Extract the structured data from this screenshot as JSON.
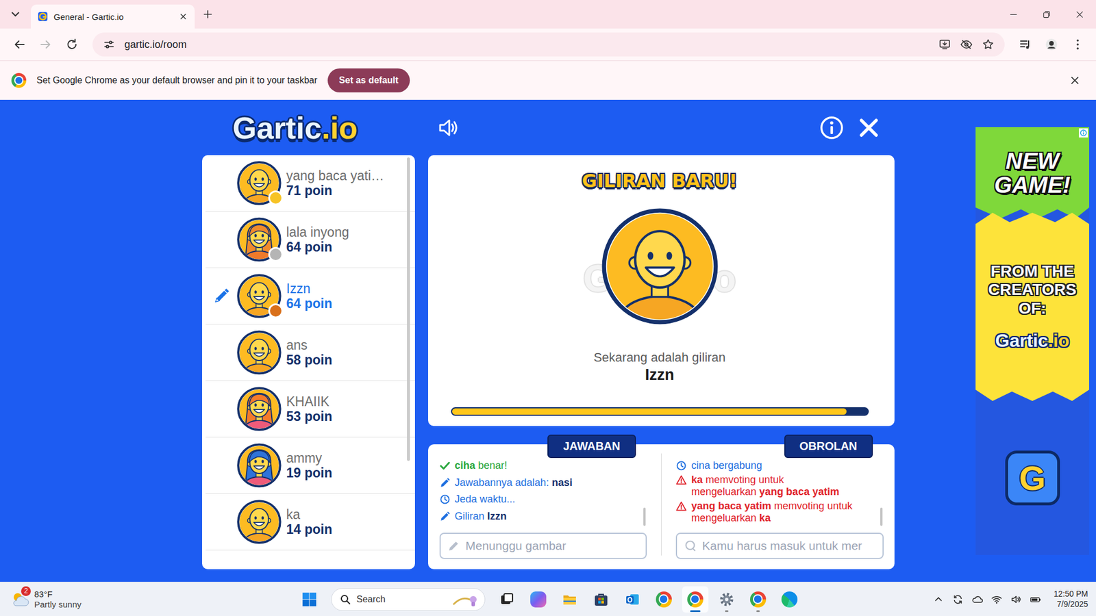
{
  "browser": {
    "tabs": [
      {
        "title": "General - Gartic.io",
        "selected": true
      }
    ],
    "address": "gartic.io/room",
    "infobar": {
      "message": "Set Google Chrome as your default browser and pin it to your taskbar",
      "button": "Set as default"
    }
  },
  "game": {
    "logo": {
      "main": "Gartic",
      "suffix": ".io"
    },
    "sound_on": true,
    "players": [
      {
        "name": "yang baca yati…",
        "points": "71 poin",
        "drawing": false,
        "avatar": {
          "kind": "man",
          "hair": null,
          "shirt": "#f6a623"
        },
        "color": "#f7c325"
      },
      {
        "name": "lala inyong",
        "points": "64 poin",
        "drawing": false,
        "avatar": {
          "kind": "woman",
          "hair": "#f08a2c",
          "shirt": "#f07a2a"
        },
        "color": "#b5b5b5"
      },
      {
        "name": "Izzn",
        "points": "64 poin",
        "drawing": true,
        "avatar": {
          "kind": "man",
          "hair": null,
          "shirt": "#f6a623"
        },
        "color": "#d9701a"
      },
      {
        "name": "ans",
        "points": "58 poin",
        "drawing": false,
        "avatar": {
          "kind": "man",
          "hair": null,
          "shirt": "#f6a623"
        },
        "color": null
      },
      {
        "name": "KHAIIK",
        "points": "53 poin",
        "drawing": false,
        "avatar": {
          "kind": "woman",
          "hair": "#f47b2a",
          "shirt": "#ef5b7a"
        },
        "color": null
      },
      {
        "name": "ammy",
        "points": "19 poin",
        "drawing": false,
        "avatar": {
          "kind": "woman",
          "hair": "#2f73d9",
          "shirt": "#ef5b7a"
        },
        "color": null
      },
      {
        "name": "ka",
        "points": "14 poin",
        "drawing": false,
        "avatar": {
          "kind": "man",
          "hair": null,
          "shirt": "#f6a623"
        },
        "color": null
      }
    ],
    "turn": {
      "title": "GILIRAN BARU!",
      "watermark": {
        "main": "Gartic",
        "suffix": ".io"
      },
      "avatar": {
        "kind": "man",
        "hair": null,
        "shirt": "#f6a623"
      },
      "caption": "Sekarang adalah giliran",
      "player": "Izzn",
      "level": 0.95
    },
    "answers": {
      "tab": "JAWABAN",
      "placeholder": "Menunggu gambar",
      "entries": [
        {
          "kind": "correct",
          "parts": [
            {
              "text": "ciha",
              "bold": true
            },
            {
              "text": "benar!",
              "bold": false
            }
          ]
        },
        {
          "kind": "answer",
          "parts": [
            {
              "text": "Jawabannya adalah:",
              "bold": false
            },
            {
              "text": "nasi",
              "bold": true
            }
          ]
        },
        {
          "kind": "pause",
          "parts": [
            {
              "text": "Jeda waktu...",
              "bold": false
            }
          ]
        },
        {
          "kind": "turn",
          "parts": [
            {
              "text": "Giliran",
              "bold": false
            },
            {
              "text": "Izzn",
              "bold": true
            }
          ]
        }
      ]
    },
    "chat": {
      "tab": "OBROLAN",
      "placeholder": "Kamu harus masuk untuk mer",
      "entries": [
        {
          "kind": "join",
          "parts": [
            {
              "text": "cina bergabung",
              "bold": false
            }
          ]
        },
        {
          "kind": "vote",
          "parts": [
            {
              "text": "ka",
              "bold": true
            },
            {
              "text": "memvoting untuk mengeluarkan",
              "bold": false
            },
            {
              "text": "yang baca yatim",
              "bold": true
            }
          ]
        },
        {
          "kind": "vote",
          "parts": [
            {
              "text": "yang baca yatim",
              "bold": true
            },
            {
              "text": "memvoting untuk mengeluarkan",
              "bold": false
            },
            {
              "text": "ka",
              "bold": true
            }
          ]
        }
      ]
    }
  },
  "ad": {
    "headline": "NEW GAME!",
    "subline": "FROM THE CREATORS OF:",
    "logo": {
      "main": "Gartic",
      "suffix": ".io"
    },
    "app_icon": "G"
  },
  "taskbar": {
    "weather": {
      "badge": "2",
      "temperature": "83°F",
      "condition": "Partly sunny"
    },
    "search": {
      "placeholder": "Search"
    },
    "apps": [
      {
        "kind": "taskview",
        "active": false,
        "running": false
      },
      {
        "kind": "copilot",
        "active": false,
        "running": false
      },
      {
        "kind": "explorer",
        "active": false,
        "running": false
      },
      {
        "kind": "store",
        "active": false,
        "running": false
      },
      {
        "kind": "outlook",
        "active": false,
        "running": false
      },
      {
        "kind": "chrome",
        "active": false,
        "running": false
      },
      {
        "kind": "chrome",
        "active": true,
        "running": true
      },
      {
        "kind": "settings",
        "active": false,
        "running": true
      },
      {
        "kind": "chrome",
        "active": false,
        "running": true
      },
      {
        "kind": "edge",
        "active": false,
        "running": false
      }
    ],
    "clock": {
      "time": "12:50 PM",
      "date": "7/9/2025"
    }
  }
}
